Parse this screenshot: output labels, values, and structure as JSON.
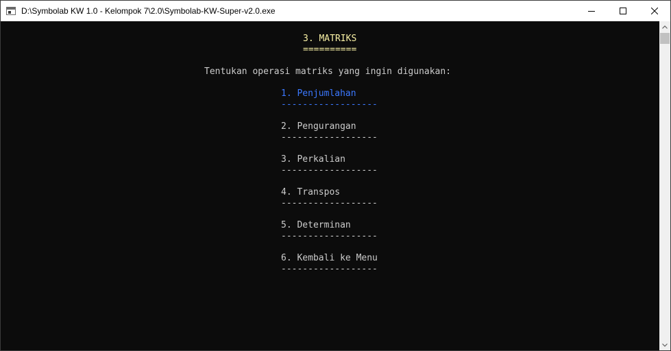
{
  "window": {
    "title": "D:\\Symbolab KW 1.0 - Kelompok 7\\2.0\\Symbolab-KW-Super-v2.0.exe"
  },
  "console": {
    "heading": "3. MATRIKS",
    "heading_underline": "==========",
    "prompt": "Tentukan operasi matriks yang ingin digunakan:",
    "separator": "------------------",
    "menu_items": [
      {
        "label": "1. Penjumlahan",
        "highlighted": true
      },
      {
        "label": "2. Pengurangan",
        "highlighted": false
      },
      {
        "label": "3. Perkalian",
        "highlighted": false
      },
      {
        "label": "4. Transpos",
        "highlighted": false
      },
      {
        "label": "5. Determinan",
        "highlighted": false
      },
      {
        "label": "6. Kembali ke Menu",
        "highlighted": false
      }
    ]
  },
  "colors": {
    "background": "#0c0c0c",
    "text": "#cccccc",
    "heading": "#f9f1a5",
    "highlight": "#3b78ff"
  }
}
